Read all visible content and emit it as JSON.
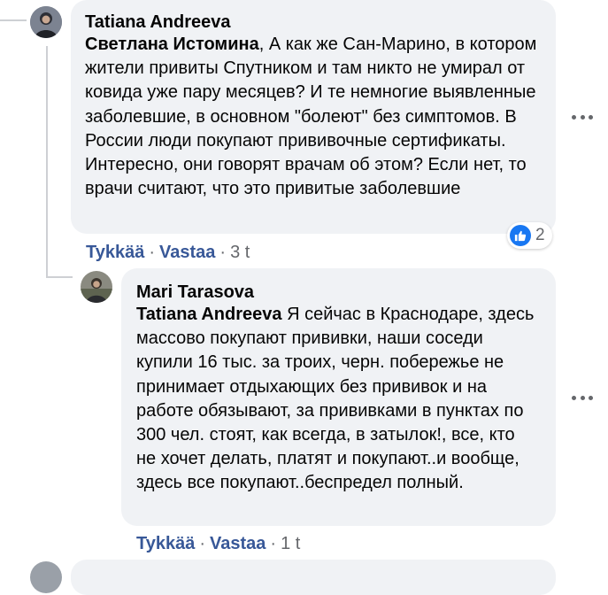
{
  "accent_color": "#385898",
  "comments": [
    {
      "author": "Tatiana Andreeva",
      "mention": "Светлана Истомина",
      "text": ", А как же Сан-Марино, в котором жители привиты Спутником и там никто не умирал от ковида уже пару месяцев? И те немногие выявленные заболевшие, в основном \"болеют\" без симптомов. В России люди покупают прививочные сертификаты. Интересно, они говорят врачам об этом? Если нет, то врачи считают, что это привитые заболевшие",
      "like_label": "Tykkää",
      "reply_label": "Vastaa",
      "separator": "·",
      "time": "3 t",
      "reaction_icon": "like-icon",
      "reaction_count": "2",
      "more_icon": "more-options-icon"
    },
    {
      "author": "Mari Tarasova",
      "mention": "Tatiana Andreeva",
      "text": " Я сейчас в Краснодаре, здесь массово покупают прививки, наши соседи купили 16 тыс. за троих, черн. побережье не принимает отдыхающих без прививок и на работе обязывают, за прививками в пунктах по 300 чел. стоят, как всегда, в затылок!, все, кто не хочет делать, платят и покупают..и вообще, здесь все покупают..беспредел полный.",
      "like_label": "Tykkää",
      "reply_label": "Vastaa",
      "separator": "·",
      "time": "1 t",
      "more_icon": "more-options-icon"
    }
  ]
}
